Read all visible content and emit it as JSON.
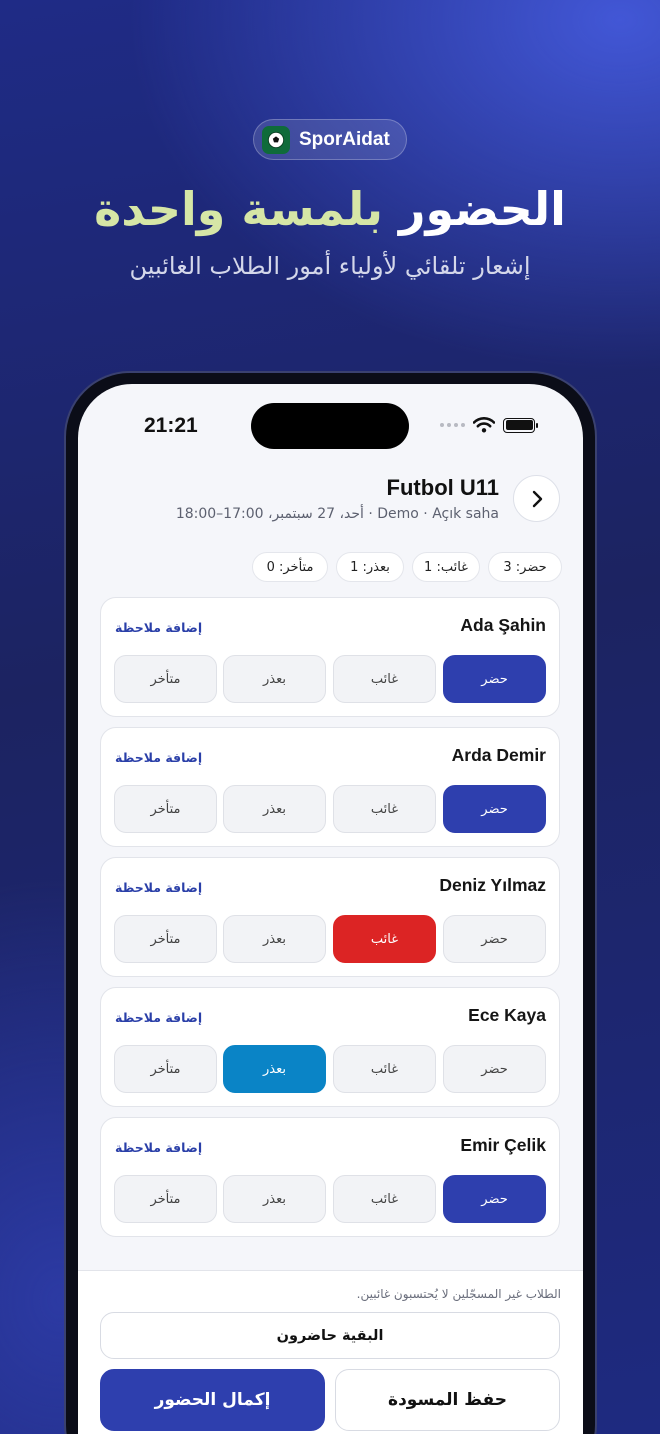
{
  "brand": {
    "name": "SporAidat"
  },
  "headline": {
    "part1": "الحضور",
    "part2": "بلمسة واحدة"
  },
  "subheadline": "إشعار تلقائي لأولياء أمور الطلاب الغائبين",
  "status_bar": {
    "time": "21:21"
  },
  "session": {
    "title": "Futbol U11",
    "meta": "أحد، 27 سبتمبر، 17:00–18:00 · Demo · Açık saha"
  },
  "stats": {
    "present": "حضر: 3",
    "absent": "غائب: 1",
    "excused": "بعذر: 1",
    "late": "متأخر: 0"
  },
  "option_labels": {
    "present": "حضر",
    "absent": "غائب",
    "excused": "بعذر",
    "late": "متأخر"
  },
  "add_note_label": "إضافة ملاحظة",
  "students": [
    {
      "name": "Ada Şahin",
      "status": "present"
    },
    {
      "name": "Arda Demir",
      "status": "present"
    },
    {
      "name": "Deniz Yılmaz",
      "status": "absent"
    },
    {
      "name": "Ece Kaya",
      "status": "excused"
    },
    {
      "name": "Emir Çelik",
      "status": "present"
    }
  ],
  "footer": {
    "note": "الطلاب غير المسجّلين لا يُحتسبون غائبين.",
    "rest_present_button": "البقية حاضرون",
    "save_draft_button": "حفظ المسودة",
    "complete_button": "إكمال الحضور"
  },
  "colors": {
    "present": "#2e3fae",
    "absent": "#dc2424",
    "excused": "#0a84c6",
    "headline_accent": "#d6e6a6"
  }
}
